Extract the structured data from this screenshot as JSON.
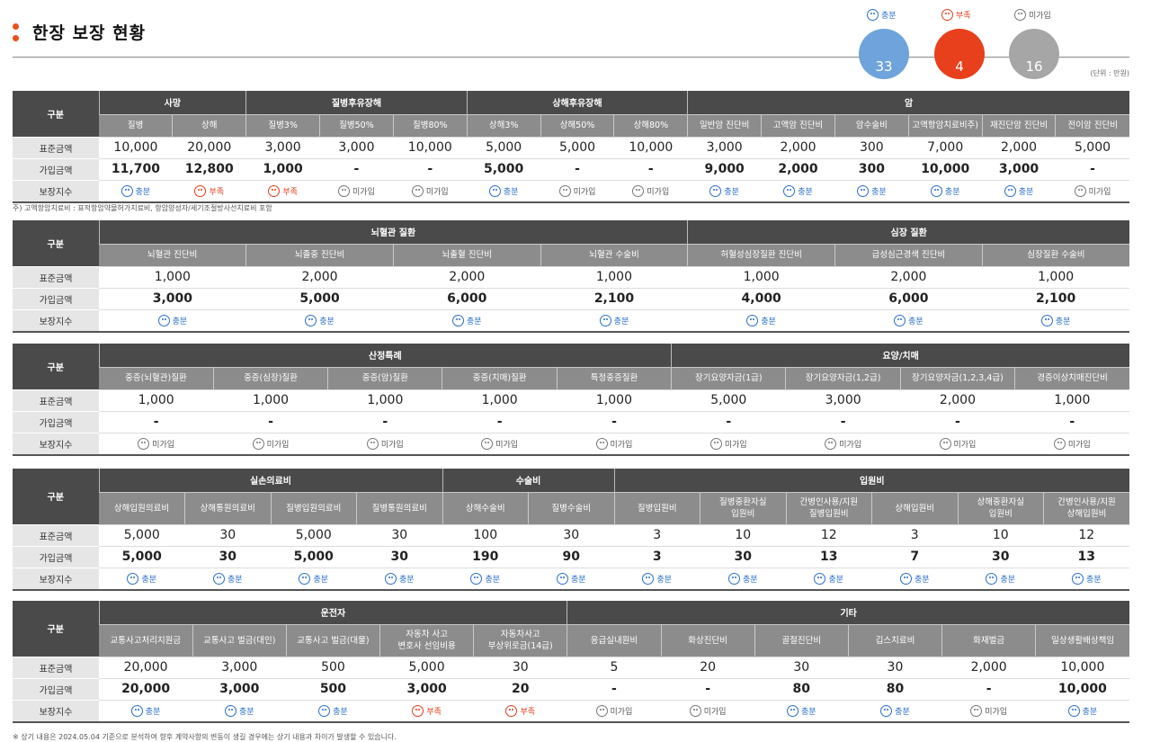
{
  "title": "한장 보장 현황",
  "summary": {
    "legend": {
      "good": "충분",
      "bad": "부족",
      "none": "미가입"
    },
    "counts": {
      "good": "33",
      "bad": "4",
      "none": "16"
    },
    "colors": {
      "good": "#6fa3db",
      "bad": "#e8401c",
      "none": "#a6a6a6"
    },
    "unit": "(단위 : 만원)"
  },
  "row_labels": {
    "group": "구분",
    "standard": "표준금액",
    "insured": "가입금액",
    "status": "보장지수"
  },
  "sections": [
    {
      "groups": [
        {
          "title": "사망",
          "cols": [
            "질병",
            "상해"
          ]
        },
        {
          "title": "질병후유장해",
          "cols": [
            "질병3%",
            "질병50%",
            "질병80%"
          ]
        },
        {
          "title": "상해후유장해",
          "cols": [
            "상해3%",
            "상해50%",
            "상해80%"
          ]
        },
        {
          "title": "암",
          "cols": [
            "일반암 진단비",
            "고액암 진단비",
            "암수술비",
            "고액항암치료비주)",
            "재진단암 진단비",
            "전이암 진단비"
          ]
        }
      ],
      "standard": [
        "10,000",
        "20,000",
        "3,000",
        "3,000",
        "10,000",
        "5,000",
        "5,000",
        "10,000",
        "3,000",
        "2,000",
        "300",
        "7,000",
        "2,000",
        "5,000"
      ],
      "insured": [
        "11,700",
        "12,800",
        "1,000",
        "-",
        "-",
        "5,000",
        "-",
        "-",
        "9,000",
        "2,000",
        "300",
        "10,000",
        "3,000",
        "-"
      ],
      "status": [
        "good",
        "bad",
        "bad",
        "none",
        "none",
        "good",
        "none",
        "none",
        "good",
        "good",
        "good",
        "good",
        "good",
        "none"
      ],
      "footnote": "주) 고액항암치료비 : 표적항암약물허가치료비, 항암양성자/세기조절방사선치료비 포함"
    },
    {
      "groups": [
        {
          "title": "뇌혈관 질환",
          "cols": [
            "뇌혈관 진단비",
            "뇌졸중 진단비",
            "뇌출혈 진단비",
            "뇌혈관 수술비"
          ]
        },
        {
          "title": "심장 질환",
          "cols": [
            "허혈성심장질환 진단비",
            "급성심근경색 진단비",
            "심장질환 수술비"
          ]
        }
      ],
      "standard": [
        "1,000",
        "2,000",
        "2,000",
        "1,000",
        "1,000",
        "2,000",
        "1,000"
      ],
      "insured": [
        "3,000",
        "5,000",
        "6,000",
        "2,100",
        "4,000",
        "6,000",
        "2,100"
      ],
      "status": [
        "good",
        "good",
        "good",
        "good",
        "good",
        "good",
        "good"
      ]
    },
    {
      "groups": [
        {
          "title": "산정특례",
          "cols": [
            "중증(뇌혈관)질환",
            "중증(심장)질환",
            "중증(암)질환",
            "중증(치매)질환",
            "특정중증질환"
          ]
        },
        {
          "title": "요양/치매",
          "cols": [
            "장기요양자금(1급)",
            "장기요양자금(1,2급)",
            "장기요양자금(1,2,3,4급)",
            "경증이상치매진단비"
          ]
        }
      ],
      "standard": [
        "1,000",
        "1,000",
        "1,000",
        "1,000",
        "1,000",
        "5,000",
        "3,000",
        "2,000",
        "1,000"
      ],
      "insured": [
        "-",
        "-",
        "-",
        "-",
        "-",
        "-",
        "-",
        "-",
        "-"
      ],
      "status": [
        "none",
        "none",
        "none",
        "none",
        "none",
        "none",
        "none",
        "none",
        "none"
      ]
    },
    {
      "groups": [
        {
          "title": "실손의료비",
          "cols": [
            "상해입원의료비",
            "상해통원의료비",
            "질병입원의료비",
            "질병통원의료비"
          ]
        },
        {
          "title": "수술비",
          "cols": [
            "상해수술비",
            "질병수술비"
          ]
        },
        {
          "title": "입원비",
          "cols": [
            "질병입원비",
            "질병중환자실\n입원비",
            "간병인사용/지원\n질병입원비",
            "상해입원비",
            "상해중환자실\n입원비",
            "간병인사용/지원\n상해입원비"
          ]
        }
      ],
      "standard": [
        "5,000",
        "30",
        "5,000",
        "30",
        "100",
        "30",
        "3",
        "10",
        "12",
        "3",
        "10",
        "12"
      ],
      "insured": [
        "5,000",
        "30",
        "5,000",
        "30",
        "190",
        "90",
        "3",
        "30",
        "13",
        "7",
        "30",
        "13"
      ],
      "status": [
        "good",
        "good",
        "good",
        "good",
        "good",
        "good",
        "good",
        "good",
        "good",
        "good",
        "good",
        "good"
      ]
    },
    {
      "groups": [
        {
          "title": "운전자",
          "cols": [
            "교통사고처리지원금",
            "교통사고 벌금(대인)",
            "교통사고 벌금(대물)",
            "자동차 사고\n변호사 선임비용",
            "자동차사고\n부상위로금(14급)"
          ]
        },
        {
          "title": "기타",
          "cols": [
            "응급실내원비",
            "화상진단비",
            "골절진단비",
            "깁스치료비",
            "화재벌금",
            "일상생활배상책임"
          ]
        }
      ],
      "standard": [
        "20,000",
        "3,000",
        "500",
        "5,000",
        "30",
        "5",
        "20",
        "30",
        "30",
        "2,000",
        "10,000"
      ],
      "insured": [
        "20,000",
        "3,000",
        "500",
        "3,000",
        "20",
        "-",
        "-",
        "80",
        "80",
        "-",
        "10,000"
      ],
      "status": [
        "good",
        "good",
        "good",
        "bad",
        "bad",
        "none",
        "none",
        "good",
        "good",
        "none",
        "good"
      ]
    }
  ],
  "bottom_note": "※ 상기 내용은 2024.05.04 기준으로 분석하여 향후 계약사항의 변동이 생길 경우에는 상기 내용과 차이가 발생할 수 있습니다."
}
